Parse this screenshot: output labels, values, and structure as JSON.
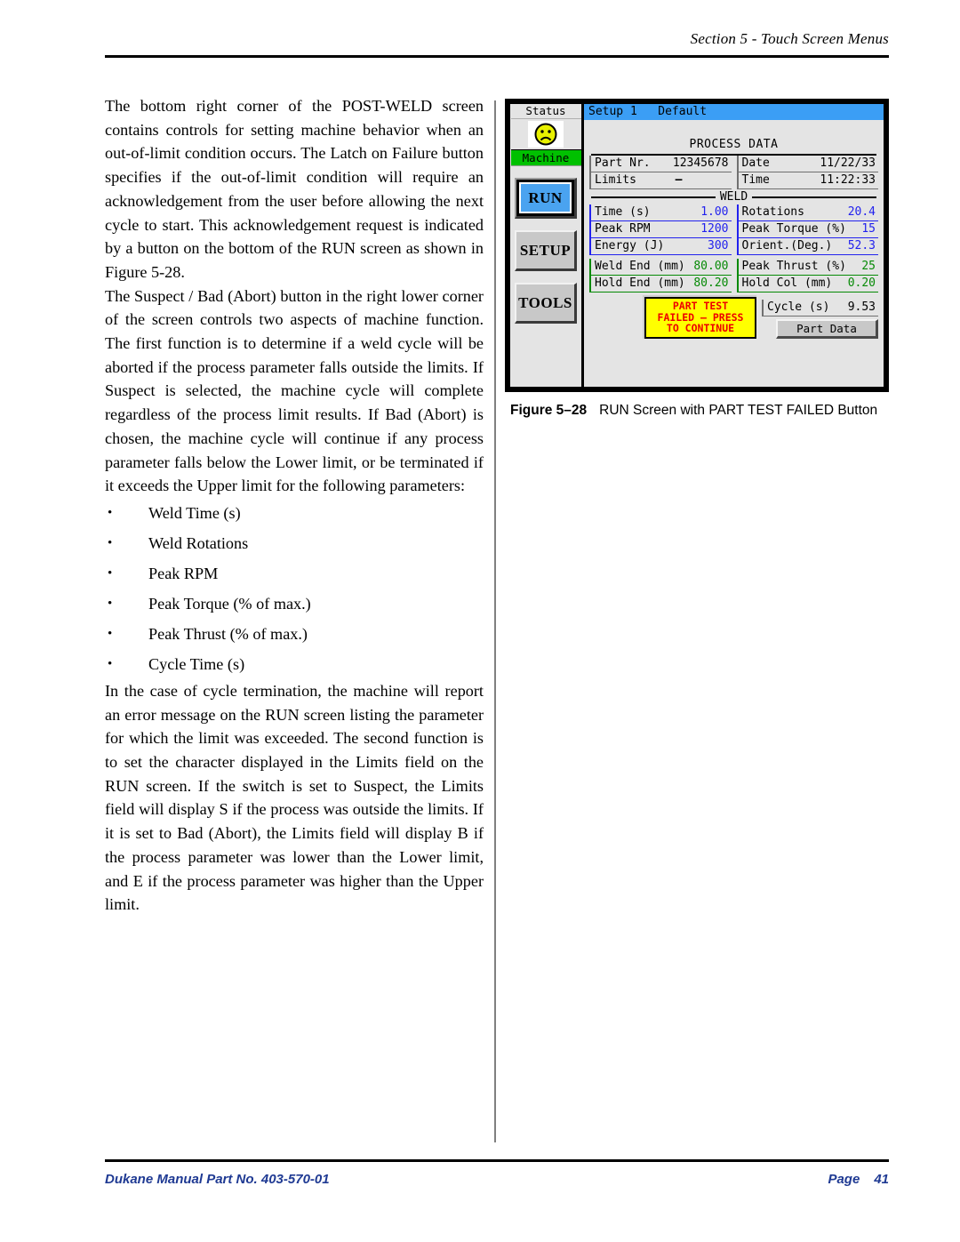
{
  "header": {
    "section": "Section 5 - Touch Screen Menus"
  },
  "footer": {
    "manual": "Dukane Manual Part No. 403-570-01",
    "page_label": "Page",
    "page_number": "41",
    "link_color": "#1f3a93"
  },
  "body": {
    "p1": "The bottom right corner of the POST-WELD screen contains controls for setting machine behavior when an out-of-limit condition occurs. The Latch on Failure button specifies if the out-of-limit condition will require an acknowledgement from the user before allowing the next cycle to start. This acknowledgement request is indicated by a button on the bottom of the RUN screen as shown in Figure 5-28.",
    "p2": "The Suspect / Bad (Abort) button in the right lower corner of the screen controls two aspects of machine function. The first function is to determine if a weld cycle will be aborted if the process parameter falls outside the limits.  If Suspect is selected, the machine cycle will complete regardless of the process limit results. If Bad (Abort) is chosen, the machine cycle will continue if any process parameter falls below the Lower limit, or be terminated if it exceeds the Upper limit for the following parameters:",
    "bullets": [
      "Weld Time (s)",
      "Weld Rotations",
      "Peak RPM",
      "Peak Torque (% of max.)",
      "Peak Thrust (% of max.)",
      "Cycle Time (s)"
    ],
    "p3": "In the case of cycle termination, the machine will report an error message on the RUN screen listing the parameter for which the limit was exceeded. The second function is to set the character displayed in the Limits field on the RUN screen.  If the switch is set to Suspect, the Limits field will display S if the process was outside the limits. If it is set to Bad (Abort), the Limits field will display B if the process parameter was lower than the Lower limit, and E if the process parameter was higher than the Upper limit."
  },
  "figure": {
    "number": "Figure 5–28",
    "title": "RUN Screen with PART TEST FAILED Button"
  },
  "touchscreen": {
    "titlebar": "Setup 1   Default",
    "status": {
      "title": "Status",
      "face_icon": "sad-face-icon",
      "machine_label": "Machine",
      "machine_color": "#00c000",
      "face_color": "#e8f000"
    },
    "rail_buttons": [
      {
        "label": "RUN",
        "active": true
      },
      {
        "label": "SETUP",
        "active": false
      },
      {
        "label": "TOOLS",
        "active": false
      }
    ],
    "process_title": "PROCESS DATA",
    "weld_divider_label": "WELD",
    "header_fields": [
      {
        "label": "Part Nr.",
        "value": "12345678",
        "color": "#000000"
      },
      {
        "label": "Date",
        "value": "11/22/33",
        "color": "#000000"
      },
      {
        "label": "Limits",
        "value": "–",
        "color": "#e00000"
      },
      {
        "label": "Time",
        "value": "11:22:33",
        "color": "#000000"
      }
    ],
    "weld_left": [
      {
        "label": "Time (s)",
        "value": "1.00"
      },
      {
        "label": "Peak RPM",
        "value": "1200"
      },
      {
        "label": "Energy (J)",
        "value": "300"
      }
    ],
    "weld_right": [
      {
        "label": "Rotations",
        "value": "20.4"
      },
      {
        "label": "Peak Torque (%)",
        "value": "15"
      },
      {
        "label": "Orient.(Deg.)",
        "value": "52.3"
      }
    ],
    "hold_left": [
      {
        "label": "Weld End (mm)",
        "value": "80.00"
      },
      {
        "label": "Hold End (mm)",
        "value": "80.20"
      }
    ],
    "hold_right": [
      {
        "label": "Peak Thrust (%)",
        "value": "25"
      },
      {
        "label": "Hold Col (mm)",
        "value": "0.20"
      }
    ],
    "cycle": {
      "label": "Cycle (s)",
      "value": "9.53"
    },
    "fail_button": {
      "line1": "PART TEST",
      "line2": "FAILED – PRESS",
      "line3": "TO CONTINUE",
      "bg": "#ffff00",
      "fg": "#ee0000"
    },
    "part_data_button": "Part Data",
    "colors": {
      "blue_value": "#2222ee",
      "green_value": "#068a06",
      "titlebar": "#3b9ef5"
    }
  }
}
